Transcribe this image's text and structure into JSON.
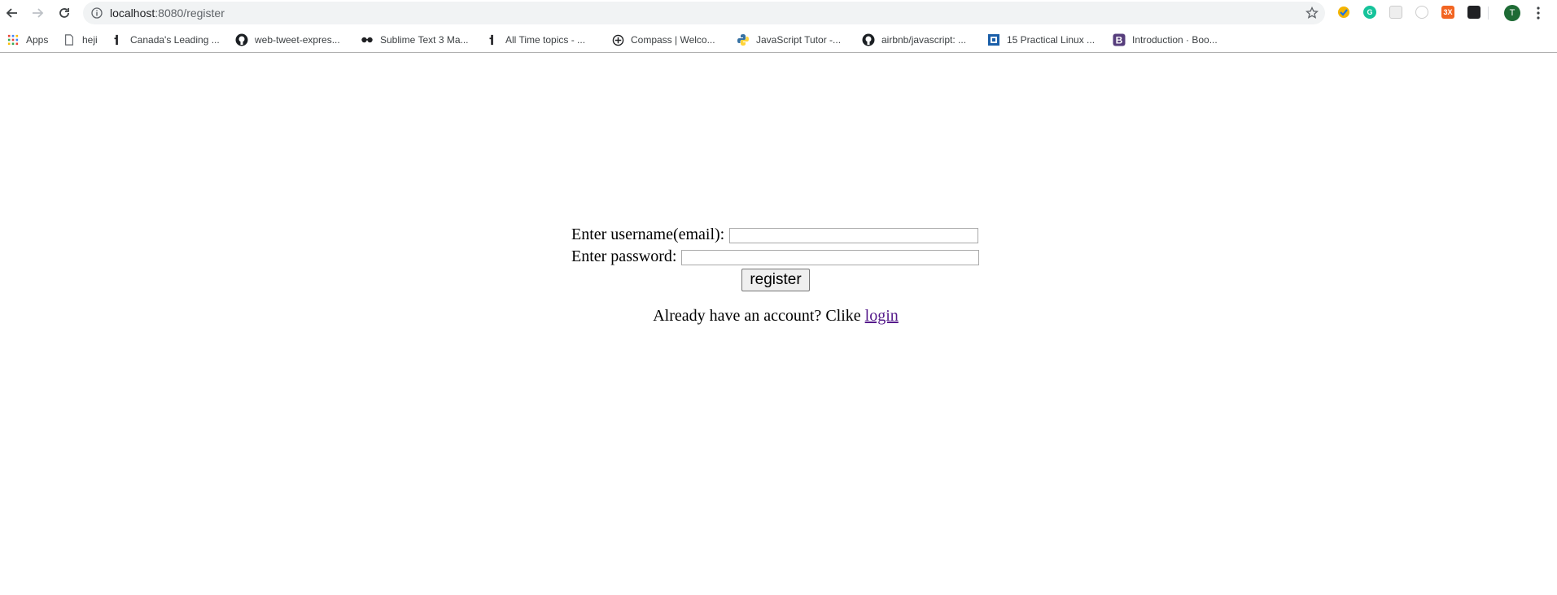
{
  "browser": {
    "url_host": "localhost",
    "url_path": ":8080/register",
    "avatar_letter": "T"
  },
  "bookmarks": [
    {
      "label": "Apps",
      "icon": "apps-grid-icon"
    },
    {
      "label": "heji",
      "icon": "document-icon"
    },
    {
      "label": "Canada's Leading ...",
      "icon": "site-favicon"
    },
    {
      "label": "web-tweet-expres...",
      "icon": "github-icon"
    },
    {
      "label": "Sublime Text 3 Ma...",
      "icon": "glasses-icon"
    },
    {
      "label": "All Time topics - ...",
      "icon": "site-favicon"
    },
    {
      "label": "Compass | Welco...",
      "icon": "compass-icon"
    },
    {
      "label": "JavaScript Tutor -...",
      "icon": "python-icon"
    },
    {
      "label": "airbnb/javascript: ...",
      "icon": "github-icon"
    },
    {
      "label": "15 Practical Linux ...",
      "icon": "site-favicon"
    },
    {
      "label": "Introduction · Boo...",
      "icon": "bootstrap-icon"
    }
  ],
  "form": {
    "username_label": "Enter username(email):",
    "username_value": "",
    "password_label": "Enter password:",
    "password_value": "",
    "submit_label": "register"
  },
  "footer": {
    "text": "Already have an account? Clike",
    "link_label": "login"
  },
  "colors": {
    "link_visited": "#551a8b",
    "avatar_bg": "#1e6b35"
  }
}
